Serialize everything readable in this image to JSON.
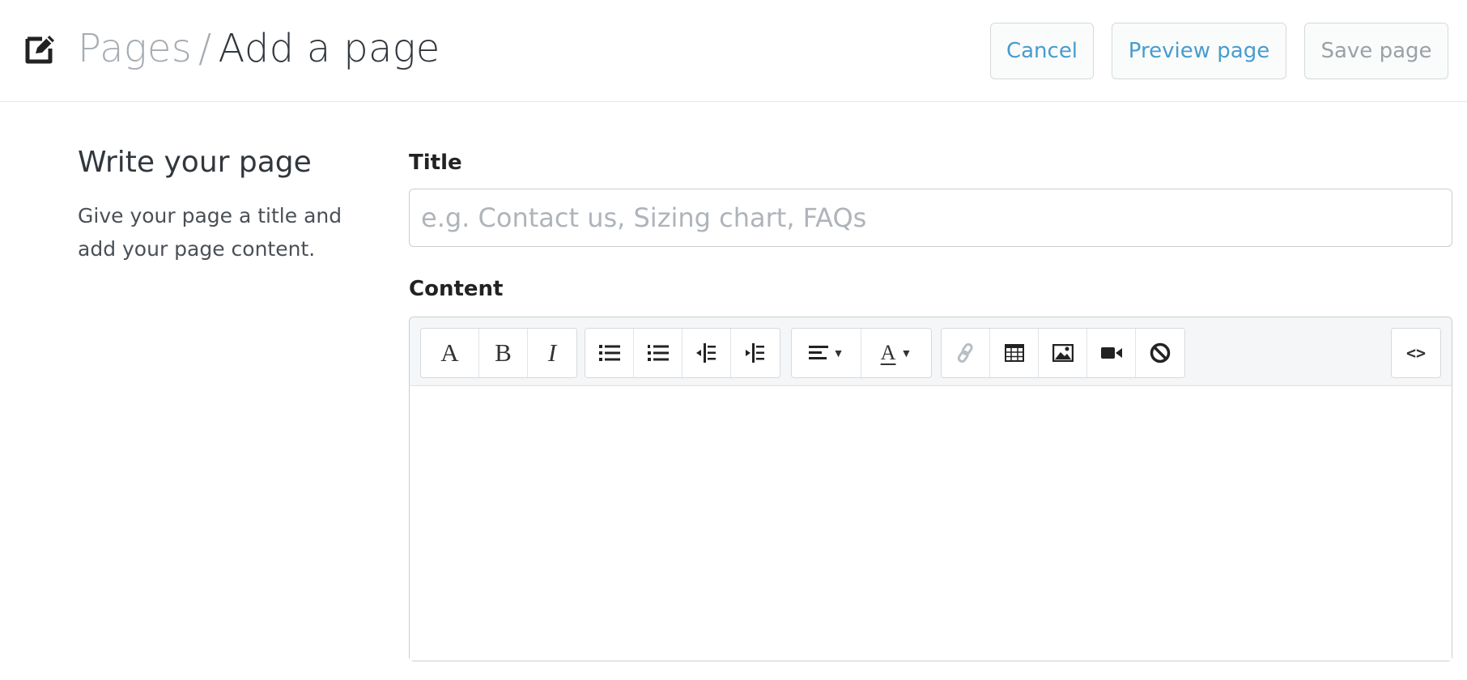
{
  "header": {
    "page_icon": "edit-page-icon",
    "breadcrumb_parent": "Pages",
    "breadcrumb_separator": "/",
    "breadcrumb_current": "Add a page",
    "buttons": {
      "cancel": "Cancel",
      "preview": "Preview page",
      "save": "Save page"
    }
  },
  "section": {
    "title": "Write your page",
    "description": "Give your page a title and add your page content."
  },
  "form": {
    "title_label": "Title",
    "title_placeholder": "e.g. Contact us, Sizing chart, FAQs",
    "title_value": "",
    "content_label": "Content"
  },
  "toolbar": {
    "font_label": "A",
    "bold_label": "B",
    "italic_label": "I",
    "text_color_label": "A",
    "html_label": "<>",
    "icons": [
      "font-icon",
      "bold-icon",
      "italic-icon",
      "bulleted-list-icon",
      "numbered-list-icon",
      "outdent-icon",
      "indent-icon",
      "align-icon",
      "text-color-icon",
      "link-icon",
      "table-icon",
      "image-icon",
      "video-icon",
      "clear-formatting-icon",
      "html-code-icon"
    ]
  },
  "colors": {
    "link_blue": "#479ccf",
    "muted_gray": "#a6acb2",
    "border": "#c9cfd4"
  }
}
